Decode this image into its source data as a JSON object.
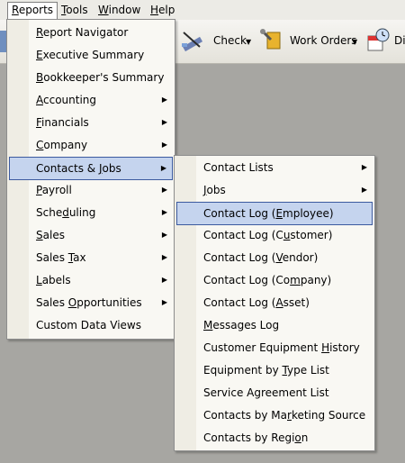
{
  "menubar": [
    {
      "pre": "",
      "u": "R",
      "post": "eports"
    },
    {
      "pre": "",
      "u": "T",
      "post": "ools"
    },
    {
      "pre": "",
      "u": "W",
      "post": "indow"
    },
    {
      "pre": "",
      "u": "H",
      "post": "elp"
    }
  ],
  "toolbar": {
    "check_label": "Check",
    "work_orders_label": "Work Orders",
    "partial_label": "Di"
  },
  "reports_menu": [
    {
      "pre": "",
      "u": "R",
      "post": "eport Navigator"
    },
    {
      "pre": "",
      "u": "E",
      "post": "xecutive Summary"
    },
    {
      "pre": "",
      "u": "B",
      "post": "ookkeeper's Summary"
    },
    {
      "pre": "",
      "u": "A",
      "post": "ccounting"
    },
    {
      "pre": "",
      "u": "F",
      "post": "inancials"
    },
    {
      "pre": "",
      "u": "C",
      "post": "ompany"
    },
    {
      "pre": "Contacts & ",
      "u": "J",
      "post": "obs"
    },
    {
      "pre": "",
      "u": "P",
      "post": "ayroll"
    },
    {
      "pre": "Sche",
      "u": "d",
      "post": "uling"
    },
    {
      "pre": "",
      "u": "S",
      "post": "ales"
    },
    {
      "pre": "Sales ",
      "u": "T",
      "post": "ax"
    },
    {
      "pre": "",
      "u": "L",
      "post": "abels"
    },
    {
      "pre": "Sales ",
      "u": "O",
      "post": "pportunities"
    },
    {
      "pre": "Custom Data Views",
      "u": "",
      "post": ""
    }
  ],
  "contacts_jobs_menu": [
    {
      "pre": "Contact Lists",
      "u": "",
      "post": ""
    },
    {
      "pre": "",
      "u": "J",
      "post": "obs"
    },
    {
      "pre": "Contact Log (",
      "u": "E",
      "post": "mployee)"
    },
    {
      "pre": "Contact Log (C",
      "u": "u",
      "post": "stomer)"
    },
    {
      "pre": "Contact Log (",
      "u": "V",
      "post": "endor)"
    },
    {
      "pre": "Contact Log (Co",
      "u": "m",
      "post": "pany)"
    },
    {
      "pre": "Contact Log (",
      "u": "A",
      "post": "sset)"
    },
    {
      "pre": "",
      "u": "M",
      "post": "essages Log"
    },
    {
      "pre": "Customer Equipment ",
      "u": "H",
      "post": "istory"
    },
    {
      "pre": "Equipment by ",
      "u": "T",
      "post": "ype List"
    },
    {
      "pre": "Service Agreement List",
      "u": "",
      "post": ""
    },
    {
      "pre": "Contacts by Ma",
      "u": "r",
      "post": "keting Source"
    },
    {
      "pre": "Contacts by Regi",
      "u": "o",
      "post": "n"
    }
  ],
  "submenu_arrow": "▶",
  "dropdown_arrow": "▼"
}
